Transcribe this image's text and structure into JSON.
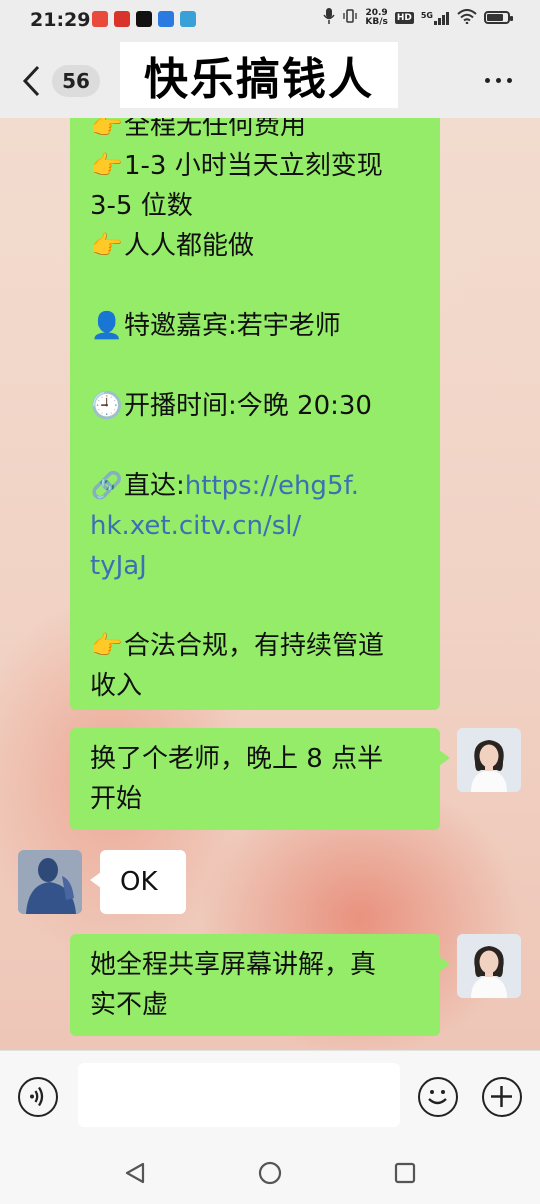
{
  "status_bar": {
    "time": "21:29",
    "net_speed": "20.9",
    "net_unit": "KB/s",
    "hd": "HD",
    "signal": "5G",
    "battery_percent": 80,
    "app_icon_colors": [
      "#e84b3c",
      "#d9342b",
      "#111111",
      "#2a7ae2",
      "#39a0d8"
    ]
  },
  "header": {
    "unread_count": "56",
    "title": "快乐搞钱人"
  },
  "messages": {
    "m1": {
      "sender": "self",
      "lines": [
        {
          "emoji": "👉",
          "text": "全程无任何费用"
        },
        {
          "emoji": "👉",
          "text": "1-3 小时当天立刻变现"
        },
        {
          "emoji": "",
          "text": "3-5 位数"
        },
        {
          "emoji": "👉",
          "text": "人人都能做"
        },
        {
          "emoji": "",
          "text": ""
        },
        {
          "emoji": "👤",
          "text": "特邀嘉宾:若宇老师"
        },
        {
          "emoji": "",
          "text": ""
        },
        {
          "emoji": "🕘",
          "text": "开播时间:今晚 20:30"
        },
        {
          "emoji": "",
          "text": ""
        },
        {
          "emoji": "🔗",
          "text": "直达:",
          "link": "https://ehg5f."
        },
        {
          "emoji": "",
          "text": "",
          "link": "hk.xet.citv.cn/sl/"
        },
        {
          "emoji": "",
          "text": "",
          "link": "tyJaJ"
        },
        {
          "emoji": "",
          "text": ""
        },
        {
          "emoji": "👉",
          "text": "合法合规，有持续管道"
        },
        {
          "emoji": "",
          "text": "收入"
        }
      ]
    },
    "m2": {
      "sender": "self",
      "lines": [
        "换了个老师，晚上 8 点半",
        "开始"
      ]
    },
    "m3": {
      "sender": "other",
      "text": "OK"
    },
    "m4": {
      "sender": "self",
      "lines": [
        "她全程共享屏幕讲解，真",
        "实不虚"
      ]
    }
  },
  "colors": {
    "self_bubble": "#95ec69",
    "other_bubble": "#ffffff",
    "link": "#3d6fb5"
  }
}
